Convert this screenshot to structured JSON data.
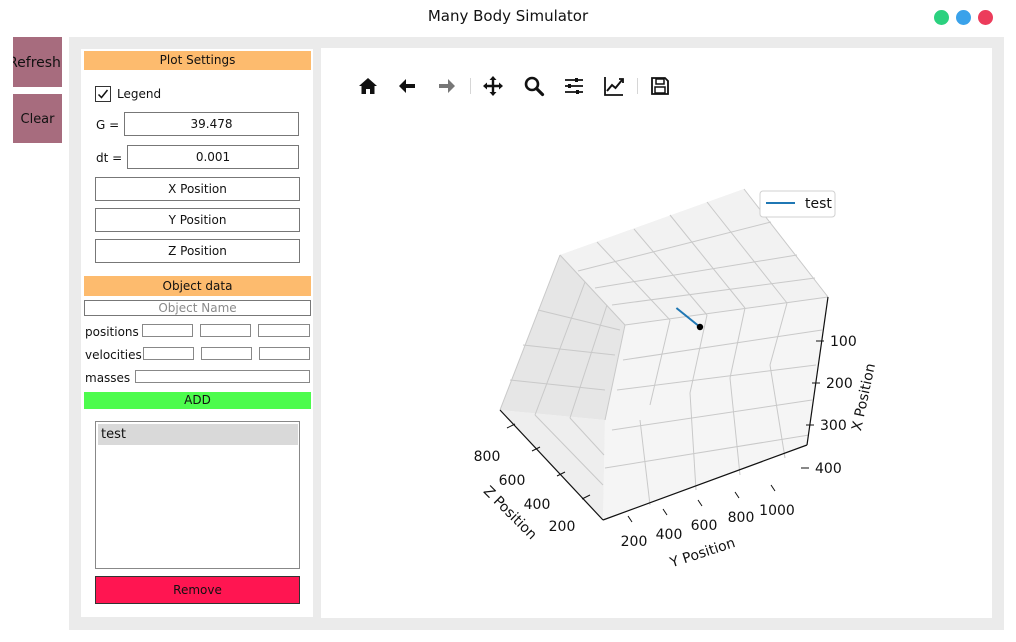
{
  "window": {
    "title": "Many Body Simulator"
  },
  "sidebar": {
    "refresh_label": "Refresh",
    "clear_label": "Clear"
  },
  "plot_settings": {
    "header": "Plot Settings",
    "legend_label": "Legend",
    "legend_checked": true,
    "g_label": "G =",
    "g_value": "39.478",
    "dt_label": "dt =",
    "dt_value": "0.001",
    "x_button": "X Position",
    "y_button": "Y Position",
    "z_button": "Z Position"
  },
  "object_data": {
    "header": "Object data",
    "name_placeholder": "Object Name",
    "positions_label": "positions",
    "velocities_label": "velocities",
    "masses_label": "masses",
    "add_label": "ADD",
    "objects": [
      "test"
    ],
    "remove_label": "Remove"
  },
  "toolbar": {
    "icons": [
      "home-icon",
      "back-icon",
      "forward-icon",
      "pan-icon",
      "zoom-icon",
      "subplots-icon",
      "edit-axes-icon",
      "save-icon"
    ]
  },
  "colors": {
    "section_header": "#fdbb6e",
    "add_button": "#4dfc4d",
    "remove_button": "#ff1551",
    "side_buttons": "#a76c7e",
    "series": "#1f77b4"
  },
  "chart_data": {
    "type": "line",
    "projection": "3d",
    "title": "",
    "xlabel": "X Position",
    "ylabel": "Y Position",
    "zlabel": "Z Position",
    "x_ticks": [
      "100",
      "200",
      "300",
      "400"
    ],
    "y_ticks": [
      "200",
      "400",
      "600",
      "800",
      "1000"
    ],
    "z_ticks": [
      "200",
      "400",
      "600",
      "800"
    ],
    "legend": {
      "entries": [
        "test"
      ],
      "placement": "top-right"
    },
    "grid": true,
    "series": [
      {
        "name": "test",
        "color": "#1f77b4",
        "points": [
          [
            150,
            430,
            480
          ],
          [
            200,
            520,
            420
          ]
        ]
      }
    ],
    "markers": [
      {
        "label": "",
        "point": [
          200,
          520,
          420
        ],
        "color": "#000000"
      }
    ]
  }
}
